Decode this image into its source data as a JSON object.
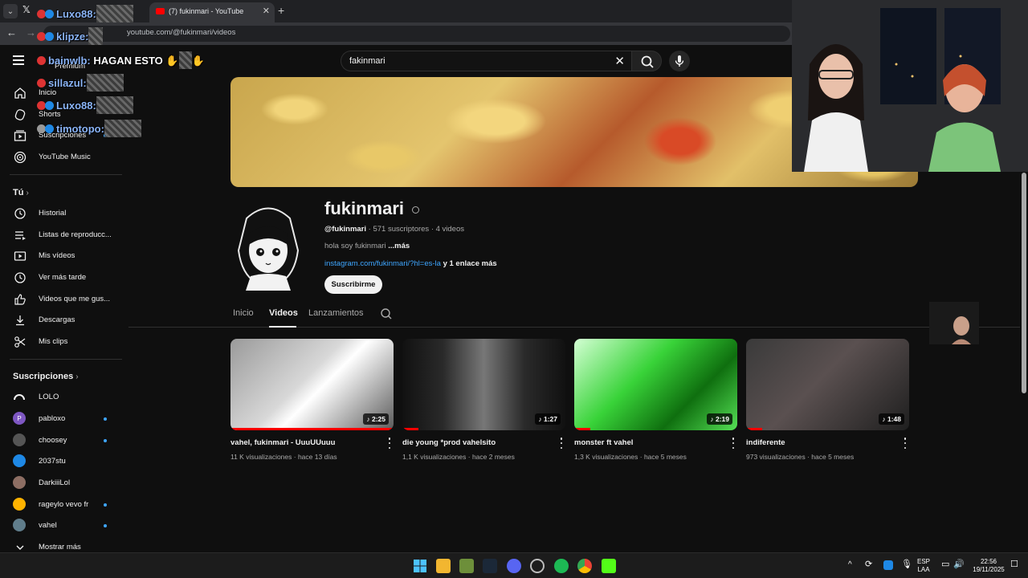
{
  "browser": {
    "tab_title": "(7) fukinmari - YouTube",
    "url": "youtube.com/@fukinmari/videos"
  },
  "search": {
    "value": "fakinmari"
  },
  "sidebar": {
    "main_items": [
      {
        "label": "Premium",
        "icon": "youtube-premium-icon"
      },
      {
        "label": "Inicio",
        "icon": "home-icon"
      },
      {
        "label": "Shorts",
        "icon": "shorts-icon"
      },
      {
        "label": "Suscripciones",
        "icon": "subscriptions-icon"
      },
      {
        "label": "YouTube Music",
        "icon": "youtube-music-icon"
      }
    ],
    "you_heading": "Tú",
    "you_items": [
      {
        "label": "Historial",
        "icon": "history-icon"
      },
      {
        "label": "Listas de reproducc...",
        "icon": "playlist-icon"
      },
      {
        "label": "Mis vídeos",
        "icon": "my-videos-icon"
      },
      {
        "label": "Ver más tarde",
        "icon": "clock-icon"
      },
      {
        "label": "Videos que me gus...",
        "icon": "thumbs-up-icon"
      },
      {
        "label": "Descargas",
        "icon": "download-icon"
      },
      {
        "label": "Mis clips",
        "icon": "scissors-icon"
      }
    ],
    "subs_heading": "Suscripciones",
    "subscriptions": [
      {
        "name": "LOLO",
        "color": "#222222",
        "new": false
      },
      {
        "name": "pabloxo",
        "color": "#7e57c2",
        "new": true,
        "initial": "P"
      },
      {
        "name": "choosey",
        "color": "#555555",
        "new": true
      },
      {
        "name": "2037stu",
        "color": "#1e88e5",
        "new": false
      },
      {
        "name": "DarkiiiLol",
        "color": "#8d6e63",
        "new": false
      },
      {
        "name": "rageylo vevo fr",
        "color": "#ffb300",
        "new": true
      },
      {
        "name": "vahel",
        "color": "#607d8b",
        "new": true
      }
    ],
    "show_more": "Mostrar más"
  },
  "channel": {
    "name": "fukinmari",
    "handle": "@fukinmari",
    "stats": " · 571 suscriptores · 4 videos",
    "description": "hola soy fukinmari ",
    "description_more": "...más",
    "link": "instagram.com/fukinmari/?hl=es-la",
    "link_more": " y 1 enlace más",
    "subscribe": "Suscribirme",
    "tabs": [
      "Inicio",
      "Videos",
      "Lanzamientos"
    ]
  },
  "videos": [
    {
      "title": "vahel, fukinmari - UuuUUuuu",
      "views": "11 K visualizaciones",
      "age": "hace 13 días",
      "duration": "2:25",
      "progress": 1.0,
      "thumb": "linear-gradient(135deg,#9a9a9a 0%,#d8d8d8 45%,#ffffff 55%,#5a5a5a 100%)"
    },
    {
      "title": "die young *prod vahelsito",
      "views": "1,1 K visualizaciones",
      "age": "hace 2 meses",
      "duration": "1:27",
      "progress": 0.1,
      "thumb": "linear-gradient(90deg,#111 0%,#2a2a2a 25%,#777 50%,#2a2a2a 75%,#111 100%)"
    },
    {
      "title": "monster ft vahel",
      "views": "1,3 K visualizaciones",
      "age": "hace 5 meses",
      "duration": "2:19",
      "progress": 0.1,
      "thumb": "linear-gradient(135deg,#d4ffd4 0%,#39d339 40%,#0f6f0f 70%,#55e055 100%)"
    },
    {
      "title": "indiferente",
      "views": "973 visualizaciones",
      "age": "hace 5 meses",
      "duration": "1:48",
      "progress": 0.1,
      "thumb": "linear-gradient(135deg,#3a3a3a 0%,#5a5050 45%,#1f1f1f 100%)"
    }
  ],
  "chat": [
    {
      "user": "Luxo88:",
      "message": ""
    },
    {
      "user": "klipze:",
      "message": ""
    },
    {
      "user": "bainwlb:",
      "message": " HAGAN ESTO "
    },
    {
      "user": "sillazul:",
      "message": ""
    },
    {
      "user": "Luxo88:",
      "message": ""
    },
    {
      "user": "timotopo:",
      "message": ""
    }
  ],
  "taskbar": {
    "language": "ESP",
    "layout": "LAA",
    "time": "22:56",
    "date": "19/11/2025"
  }
}
